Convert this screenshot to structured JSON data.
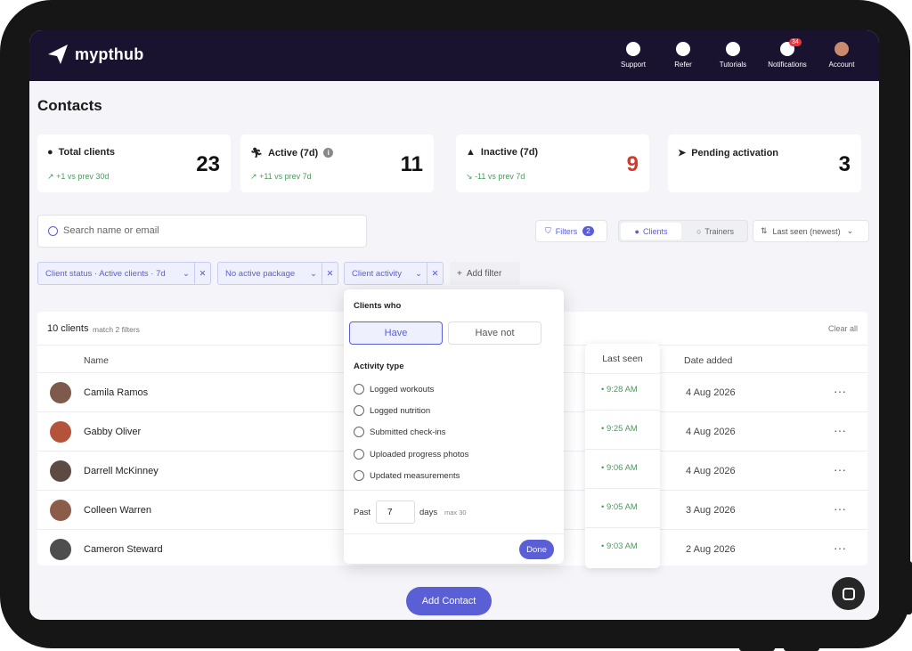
{
  "app": {
    "brand": "mypthub"
  },
  "nav": [
    {
      "label": "Support",
      "icon": "headset-icon"
    },
    {
      "label": "Refer",
      "icon": "dollar-icon"
    },
    {
      "label": "Tutorials",
      "icon": "play-icon"
    },
    {
      "label": "Notifications",
      "icon": "bell-icon",
      "badge": "34"
    },
    {
      "label": "Account",
      "icon": "avatar-icon"
    }
  ],
  "page": {
    "title": "Contacts"
  },
  "stats": [
    {
      "label": "Total clients",
      "value": "23",
      "sub": "+1 vs prev 30d",
      "icon": "users-icon"
    },
    {
      "label": "Active (7d)",
      "value": "11",
      "sub": "+11 vs prev 7d",
      "icon": "running-icon"
    },
    {
      "label": "Inactive (7d)",
      "value": "9",
      "sub": "-11 vs prev 7d",
      "icon": "warning-icon",
      "value_color": "#d33a2c"
    },
    {
      "label": "Pending activation",
      "value": "3",
      "sub": "",
      "icon": "send-icon"
    }
  ],
  "search": {
    "placeholder": "Search name or email"
  },
  "toolbar": {
    "filters_label": "Filters",
    "filters_count": "2",
    "clients_label": "Clients",
    "trainers_label": "Trainers",
    "sort_label": "Last seen (newest)"
  },
  "chips": [
    {
      "label": "Client status · Active clients · 7d"
    },
    {
      "label": "No active package"
    },
    {
      "label": "Client activity"
    }
  ],
  "add_filter": "Add filter",
  "table": {
    "count": "10 clients",
    "match": "match 2 filters",
    "clear_all": "Clear all",
    "columns": {
      "name": "Name",
      "last_seen": "Last seen",
      "date_added": "Date added"
    },
    "rows": [
      {
        "name": "Camila Ramos",
        "last_seen": "9:28 AM",
        "date_added": "4 Aug 2026"
      },
      {
        "name": "Gabby Oliver",
        "last_seen": "9:25 AM",
        "date_added": "4 Aug 2026"
      },
      {
        "name": "Darrell McKinney",
        "last_seen": "9:06 AM",
        "date_added": "4 Aug 2026"
      },
      {
        "name": "Colleen Warren",
        "last_seen": "9:05 AM",
        "date_added": "3 Aug 2026"
      },
      {
        "name": "Cameron Steward",
        "last_seen": "9:03 AM",
        "date_added": "2 Aug 2026"
      }
    ]
  },
  "popover": {
    "heading": "Clients who",
    "have": "Have",
    "have_not": "Have not",
    "activity_heading": "Activity type",
    "options": [
      "Logged workouts",
      "Logged nutrition",
      "Submitted check-ins",
      "Uploaded progress photos",
      "Updated measurements"
    ],
    "past_label": "Past",
    "past_value": "7",
    "days_label": "days",
    "max_label": "max 30",
    "done": "Done"
  },
  "add_contact": "Add Contact",
  "colors": {
    "accent": "#5b5fd6",
    "topbar": "#1a1330",
    "positive": "#4c9a5e",
    "negative": "#d33a2c"
  }
}
